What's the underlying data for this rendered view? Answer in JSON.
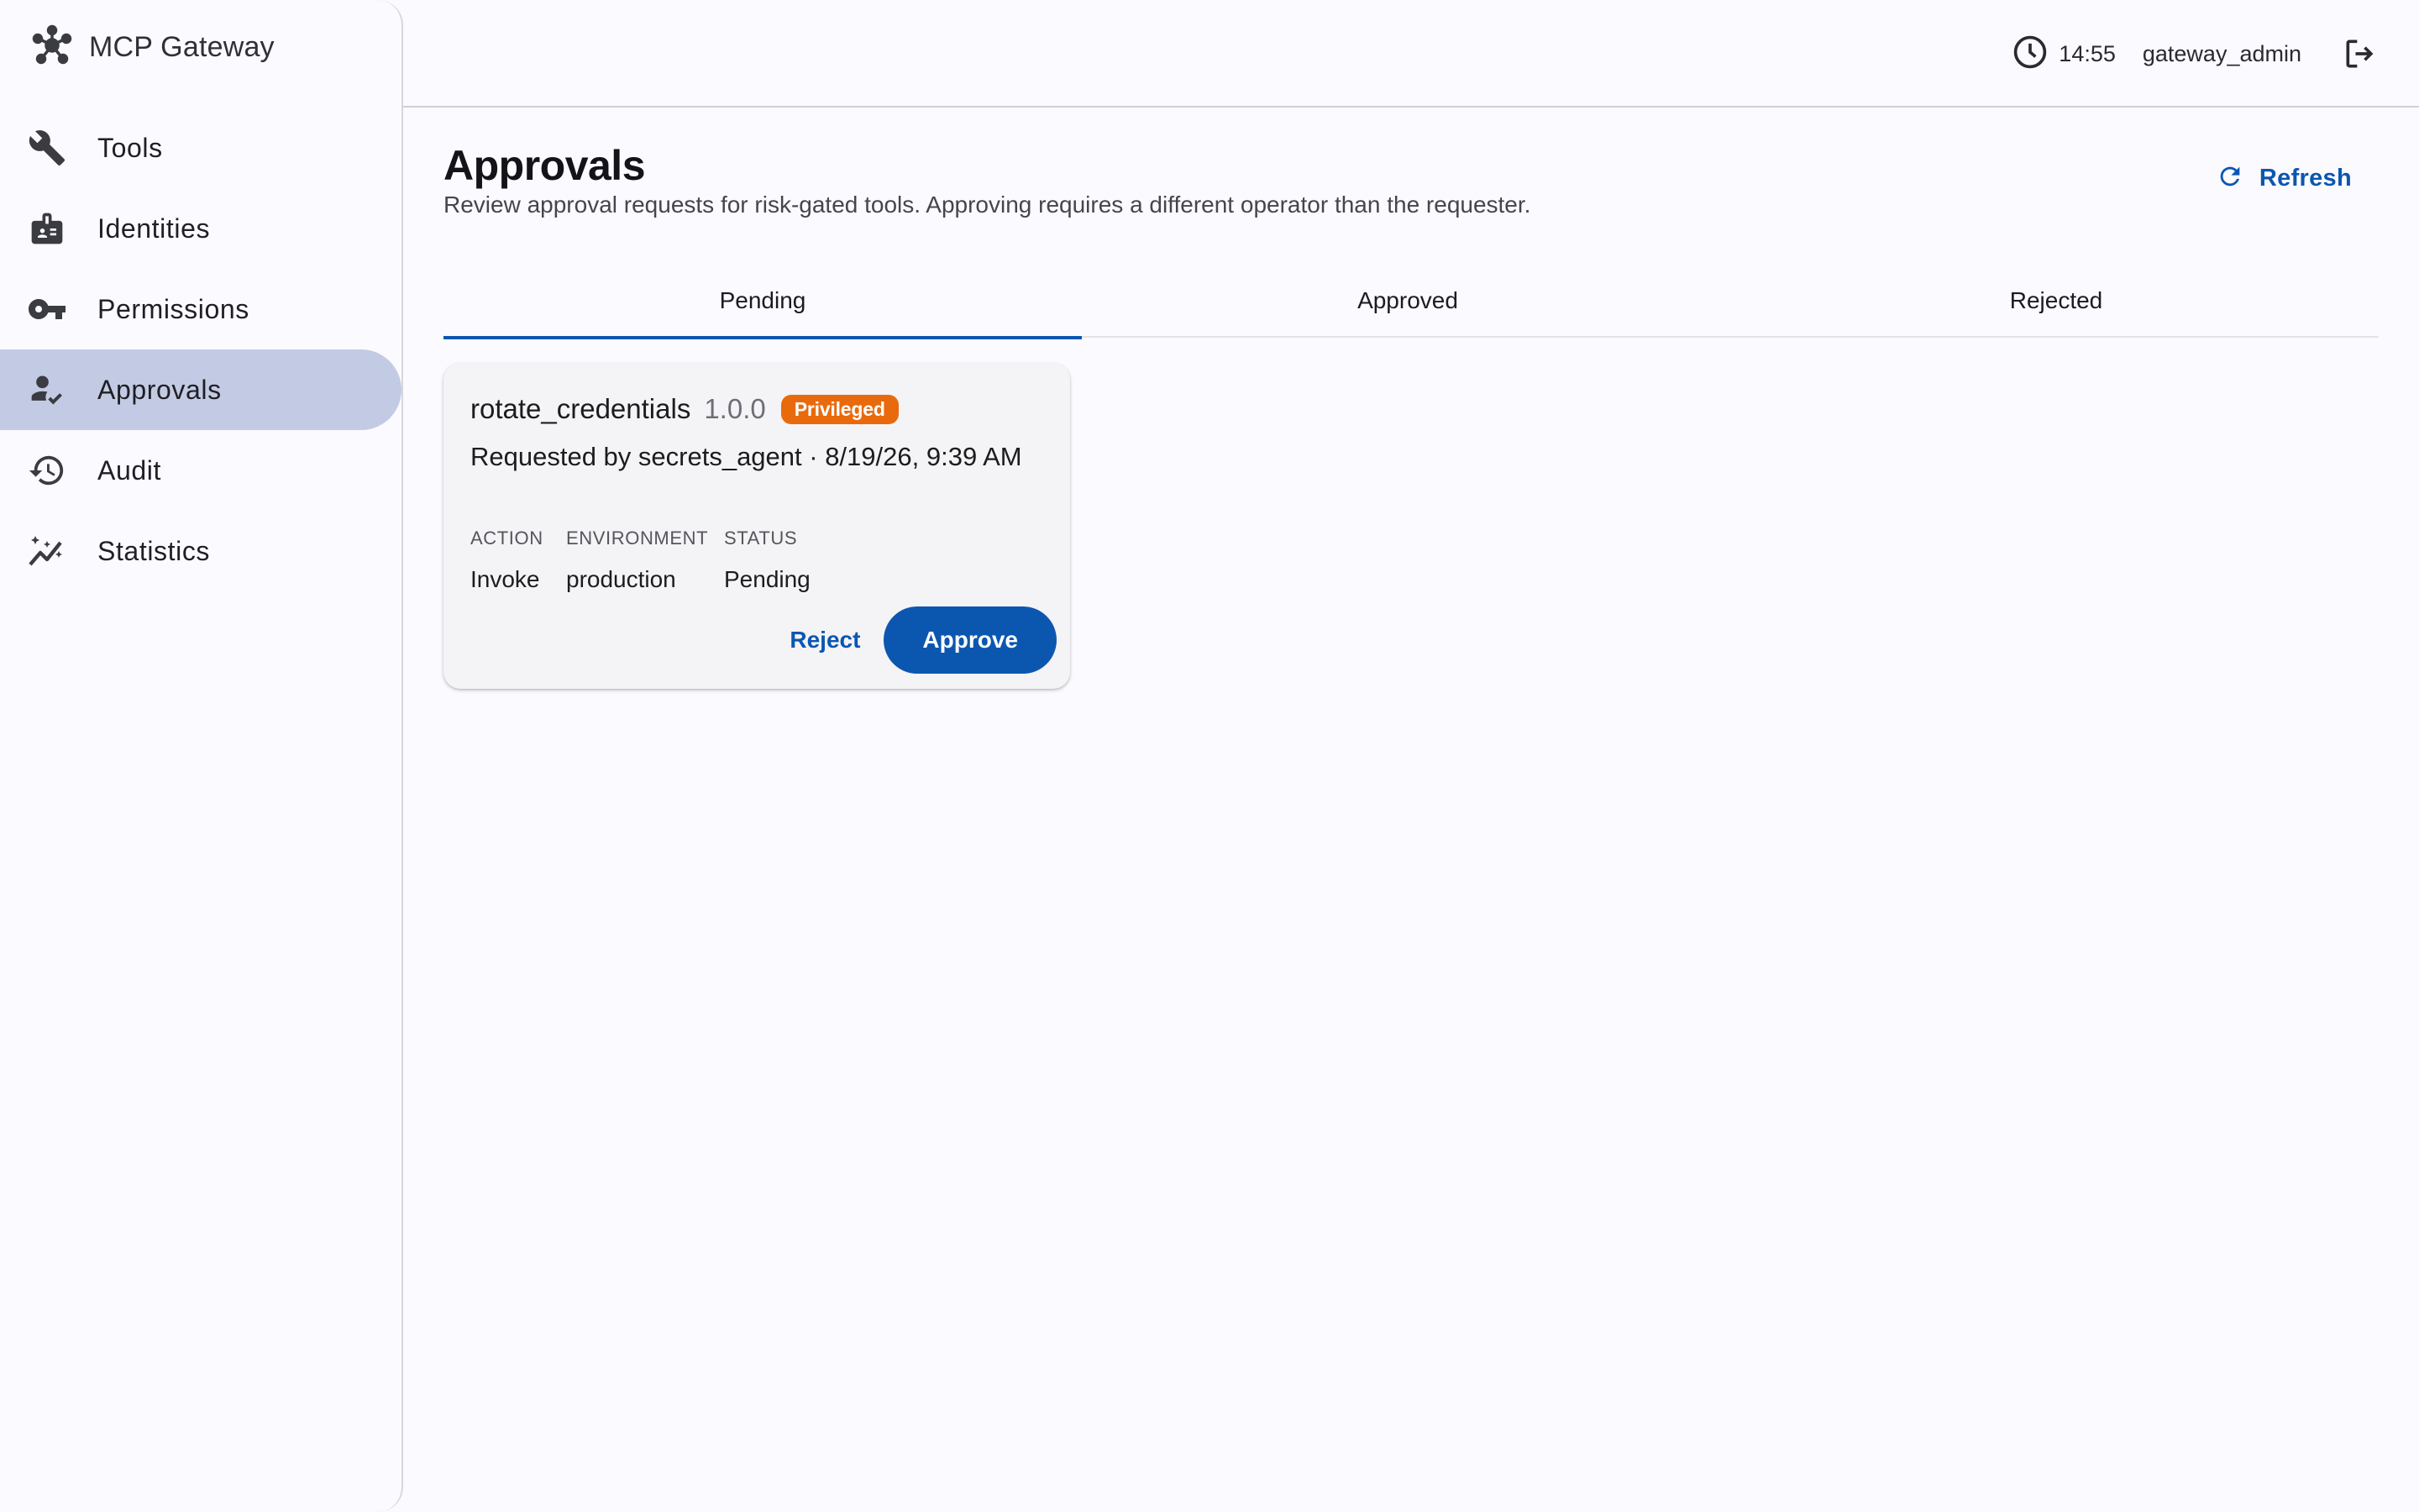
{
  "app": {
    "title": "MCP Gateway"
  },
  "sidebar": {
    "items": [
      {
        "label": "Tools",
        "icon": "wrench-icon"
      },
      {
        "label": "Identities",
        "icon": "badge-icon"
      },
      {
        "label": "Permissions",
        "icon": "key-icon"
      },
      {
        "label": "Approvals",
        "icon": "approval-person-icon",
        "active": true
      },
      {
        "label": "Audit",
        "icon": "history-icon"
      },
      {
        "label": "Statistics",
        "icon": "sparkline-icon"
      }
    ]
  },
  "header": {
    "time": "14:55",
    "user": "gateway_admin"
  },
  "page": {
    "title": "Approvals",
    "subtitle": "Review approval requests for risk-gated tools. Approving requires a different operator than the requester.",
    "refresh_label": "Refresh"
  },
  "tabs": [
    {
      "label": "Pending",
      "active": true
    },
    {
      "label": "Approved"
    },
    {
      "label": "Rejected"
    }
  ],
  "requests": [
    {
      "tool_name": "rotate_credentials",
      "version": "1.0.0",
      "badge": "Privileged",
      "requested_by": "Requested by secrets_agent · 8/19/26, 9:39 AM",
      "fields": [
        {
          "label": "ACTION",
          "value": "Invoke"
        },
        {
          "label": "ENVIRONMENT",
          "value": "production"
        },
        {
          "label": "STATUS",
          "value": "Pending"
        }
      ],
      "reject_label": "Reject",
      "approve_label": "Approve"
    }
  ],
  "colors": {
    "accent": "#0b57b0",
    "active_nav": "#c3cbe4",
    "badge_privileged": "#e96a0c",
    "background": "#fbfaff",
    "card": "#f4f3f6"
  }
}
